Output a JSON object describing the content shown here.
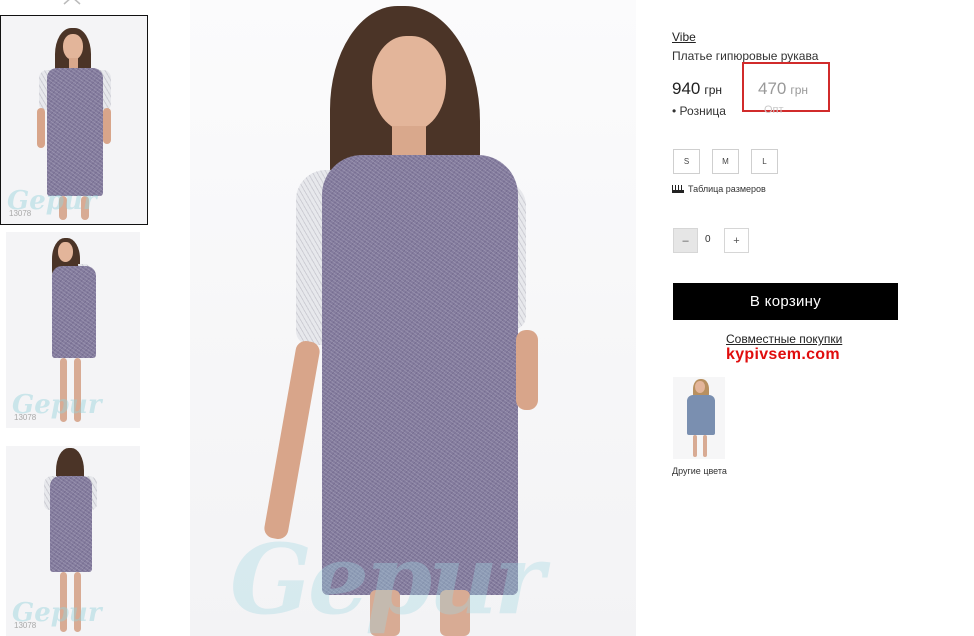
{
  "thumbnails": [
    {
      "code": "13078"
    },
    {
      "code": "13078"
    },
    {
      "code": "13078"
    }
  ],
  "watermark": "Gepur",
  "product": {
    "brand": "Vibe",
    "name": "Платье гипюровые рукава",
    "retail_price": "940",
    "retail_currency": "грн",
    "retail_label": "Розница",
    "opt_price": "470",
    "opt_currency": "грн",
    "opt_label": "Опт"
  },
  "sizes": [
    "S",
    "M",
    "L"
  ],
  "size_table_label": "Таблица размеров",
  "quantity": {
    "minus": "–",
    "value": "0",
    "plus": "+"
  },
  "cart_button": "В корзину",
  "joint_purchases": "Совместные покупки",
  "site_logo": "kypivsem.com",
  "other_colors_label": "Другие цвета",
  "colors": {
    "accent_box": "#d12b2b",
    "logo_red": "#e00d0d",
    "dress": "#837b9d",
    "other_dress": "#7a8fb0"
  }
}
